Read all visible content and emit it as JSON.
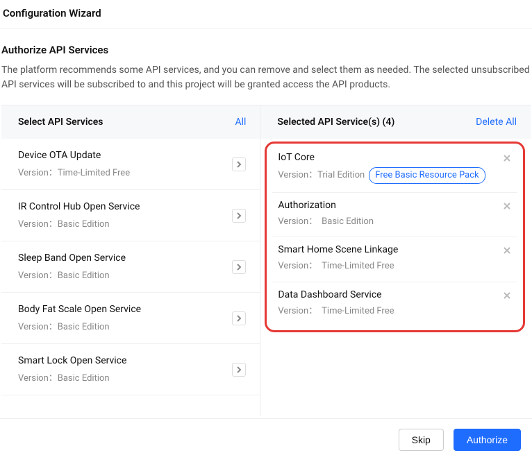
{
  "header": {
    "title": "Configuration Wizard"
  },
  "section": {
    "title": "Authorize API Services",
    "desc": "The platform recommends some API services, and you can remove and select them as needed. The selected unsubscribed API services will be subscribed to and this project will be granted access the API products."
  },
  "panels": {
    "left_title": "Select API Services",
    "left_action": "All",
    "right_title": "Selected API Service(s) (4)",
    "right_action": "Delete All",
    "version_label": "Version："
  },
  "available": [
    {
      "name": "Device OTA Update",
      "version": "Time-Limited Free"
    },
    {
      "name": "IR Control Hub Open Service",
      "version": "Basic Edition"
    },
    {
      "name": "Sleep Band Open Service",
      "version": "Basic Edition"
    },
    {
      "name": "Body Fat Scale Open Service",
      "version": "Basic Edition"
    },
    {
      "name": "Smart Lock Open Service",
      "version": "Basic Edition"
    }
  ],
  "selected": [
    {
      "name": "IoT Core",
      "version": "Trial Edition",
      "badge": "Free Basic Resource Pack"
    },
    {
      "name": "Authorization",
      "version": "Basic Edition"
    },
    {
      "name": "Smart Home Scene Linkage",
      "version": "Time-Limited Free"
    },
    {
      "name": "Data Dashboard Service",
      "version": "Time-Limited Free"
    }
  ],
  "footer": {
    "skip": "Skip",
    "authorize": "Authorize"
  }
}
